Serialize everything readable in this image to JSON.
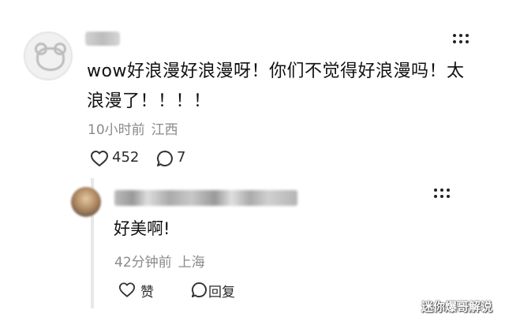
{
  "comment": {
    "text": "wow好浪漫好浪漫呀！你们不觉得好浪漫吗！太浪漫了！！！！",
    "time": "10小时前",
    "location": "江西",
    "like_count": "452",
    "reply_count": "7",
    "more_label": "⋮⋮"
  },
  "reply": {
    "text": "好美啊!",
    "time": "42分钟前",
    "location": "上海",
    "like_label": "赞",
    "reply_label": "回复",
    "more_label": "⋮⋮"
  },
  "watermark": "迷你爆哥解说"
}
